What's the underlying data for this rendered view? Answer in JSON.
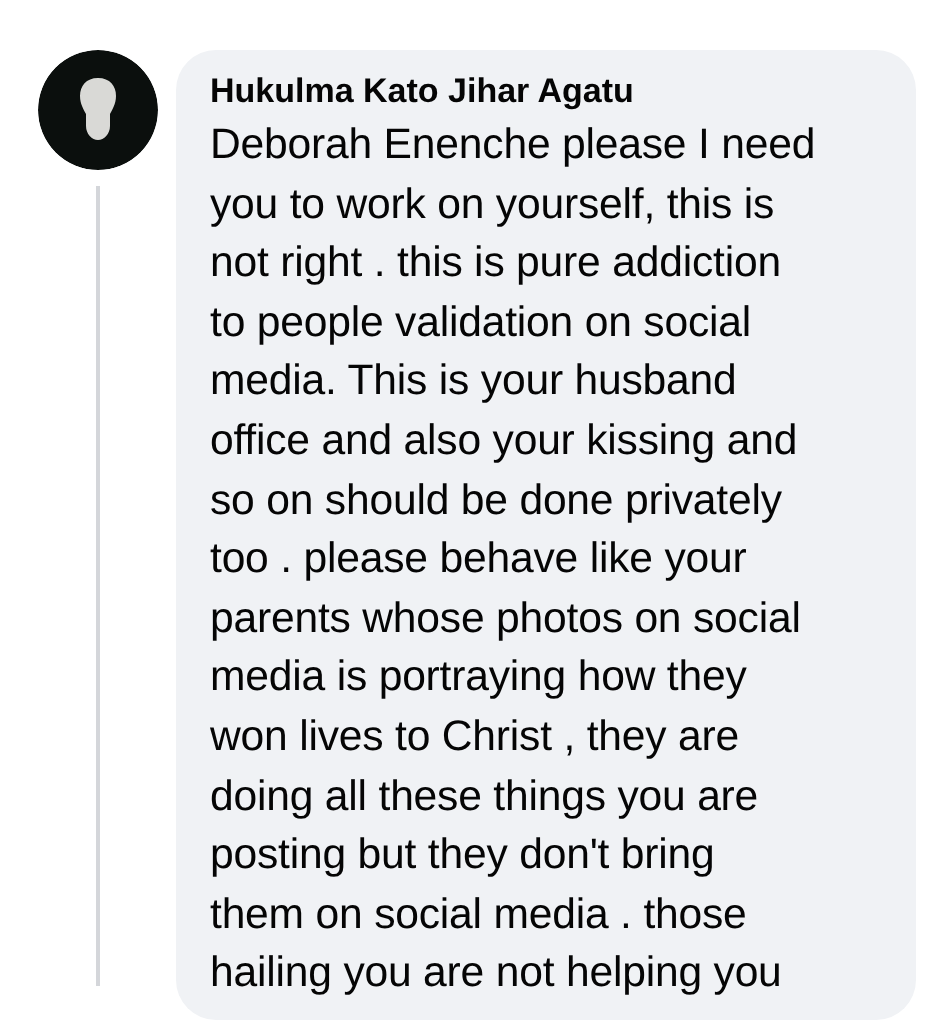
{
  "comment": {
    "author": "Hukulma Kato Jihar Agatu",
    "text": "Deborah Enenche please I need\nyou to work on yourself, this is\nnot right . this is pure addiction\nto people validation on social\nmedia. This is your husband\noffice and also your kissing and\nso on should be done privately\ntoo . please behave like your\nparents whose photos on social\nmedia is portraying how they\nwon lives to Christ , they are\ndoing all these things you are\nposting but they don't bring\nthem on social media . those\nhailing you are not helping you"
  }
}
